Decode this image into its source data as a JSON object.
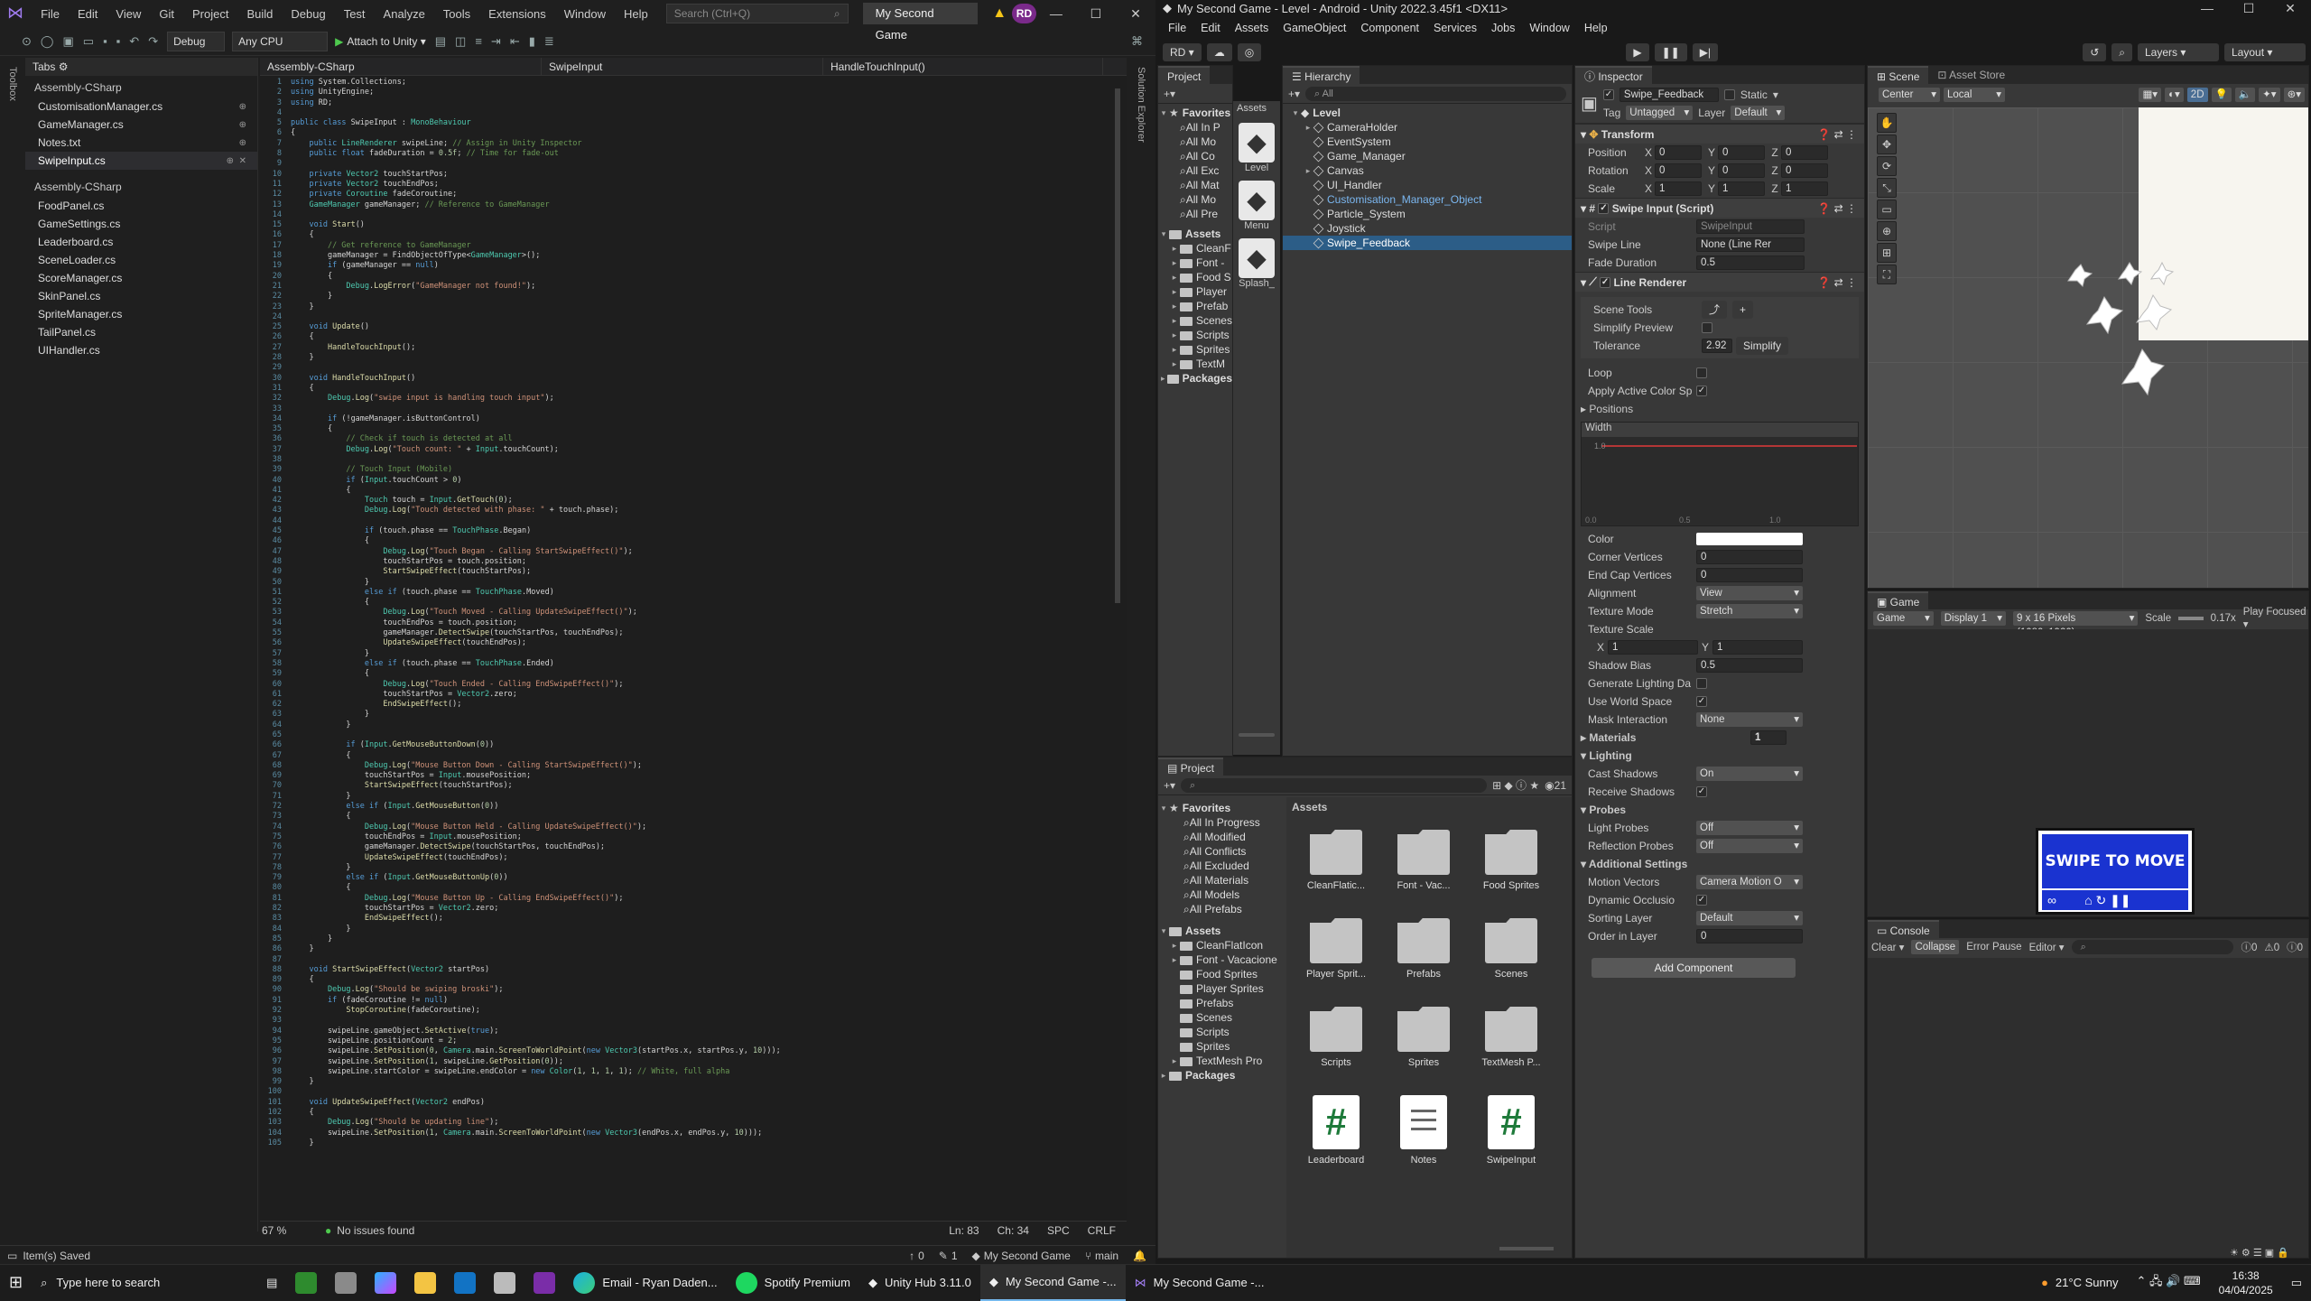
{
  "vs": {
    "menu": [
      "File",
      "Edit",
      "View",
      "Git",
      "Project",
      "Build",
      "Debug",
      "Test",
      "Analyze",
      "Tools",
      "Extensions",
      "Window",
      "Help"
    ],
    "search_placeholder": "Search (Ctrl+Q)",
    "solution_name": "My Second Game",
    "avatar": "RD",
    "config": "Debug",
    "platform": "Any CPU",
    "attach": "Attach to Unity",
    "left_strip": "Toolbox",
    "right_strip": "Solution Explorer",
    "tabs_header": "Tabs",
    "tab_groups": [
      {
        "name": "Assembly-CSharp",
        "items": [
          "CustomisationManager.cs",
          "GameManager.cs",
          "Notes.txt",
          "SwipeInput.cs"
        ]
      },
      {
        "name": "Assembly-CSharp",
        "items": [
          "FoodPanel.cs",
          "GameSettings.cs",
          "Leaderboard.cs",
          "SceneLoader.cs",
          "ScoreManager.cs",
          "SkinPanel.cs",
          "SpriteManager.cs",
          "TailPanel.cs",
          "UIHandler.cs"
        ]
      }
    ],
    "nav": [
      "Assembly-CSharp",
      "SwipeInput",
      "HandleTouchInput()"
    ],
    "status_editor": {
      "zoom": "67 %",
      "issues": "No issues found",
      "ln": "Ln: 83",
      "ch": "Ch: 34",
      "spc": "SPC",
      "crlf": "CRLF"
    },
    "status": {
      "saved": "Item(s) Saved",
      "up": "0",
      "pen": "1",
      "repo": "My Second Game",
      "branch": "main"
    },
    "code": [
      "using System.Collections;",
      "using UnityEngine;",
      "using RD;",
      "",
      "public class SwipeInput : MonoBehaviour",
      "{",
      "    public LineRenderer swipeLine; // Assign in Unity Inspector",
      "    public float fadeDuration = 0.5f; // Time for fade-out",
      "",
      "    private Vector2 touchStartPos;",
      "    private Vector2 touchEndPos;",
      "    private Coroutine fadeCoroutine;",
      "    GameManager gameManager; // Reference to GameManager",
      "",
      "    void Start()",
      "    {",
      "        // Get reference to GameManager",
      "        gameManager = FindObjectOfType<GameManager>();",
      "        if (gameManager == null)",
      "        {",
      "            Debug.LogError(\"GameManager not found!\");",
      "        }",
      "    }",
      "",
      "    void Update()",
      "    {",
      "        HandleTouchInput();",
      "    }",
      "",
      "    void HandleTouchInput()",
      "    {",
      "        Debug.Log(\"swipe input is handling touch input\");",
      "",
      "        if (!gameManager.isButtonControl)",
      "        {",
      "            // Check if touch is detected at all",
      "            Debug.Log(\"Touch count: \" + Input.touchCount);",
      "",
      "            // Touch Input (Mobile)",
      "            if (Input.touchCount > 0)",
      "            {",
      "                Touch touch = Input.GetTouch(0);",
      "                Debug.Log(\"Touch detected with phase: \" + touch.phase);",
      "",
      "                if (touch.phase == TouchPhase.Began)",
      "                {",
      "                    Debug.Log(\"Touch Began - Calling StartSwipeEffect()\");",
      "                    touchStartPos = touch.position;",
      "                    StartSwipeEffect(touchStartPos);",
      "                }",
      "                else if (touch.phase == TouchPhase.Moved)",
      "                {",
      "                    Debug.Log(\"Touch Moved - Calling UpdateSwipeEffect()\");",
      "                    touchEndPos = touch.position;",
      "                    gameManager.DetectSwipe(touchStartPos, touchEndPos);",
      "                    UpdateSwipeEffect(touchEndPos);",
      "                }",
      "                else if (touch.phase == TouchPhase.Ended)",
      "                {",
      "                    Debug.Log(\"Touch Ended - Calling EndSwipeEffect()\");",
      "                    touchStartPos = Vector2.zero;",
      "                    EndSwipeEffect();",
      "                }",
      "            }",
      "",
      "            if (Input.GetMouseButtonDown(0))",
      "            {",
      "                Debug.Log(\"Mouse Button Down - Calling StartSwipeEffect()\");",
      "                touchStartPos = Input.mousePosition;",
      "                StartSwipeEffect(touchStartPos);",
      "            }",
      "            else if (Input.GetMouseButton(0))",
      "            {",
      "                Debug.Log(\"Mouse Button Held - Calling UpdateSwipeEffect()\");",
      "                touchEndPos = Input.mousePosition;",
      "                gameManager.DetectSwipe(touchStartPos, touchEndPos);",
      "                UpdateSwipeEffect(touchEndPos);",
      "            }",
      "            else if (Input.GetMouseButtonUp(0))",
      "            {",
      "                Debug.Log(\"Mouse Button Up - Calling EndSwipeEffect()\");",
      "                touchStartPos = Vector2.zero;",
      "                EndSwipeEffect();",
      "            }",
      "        }",
      "    }",
      "",
      "    void StartSwipeEffect(Vector2 startPos)",
      "    {",
      "        Debug.Log(\"Should be swiping broski\");",
      "        if (fadeCoroutine != null)",
      "            StopCoroutine(fadeCoroutine);",
      "",
      "        swipeLine.gameObject.SetActive(true);",
      "        swipeLine.positionCount = 2;",
      "        swipeLine.SetPosition(0, Camera.main.ScreenToWorldPoint(new Vector3(startPos.x, startPos.y, 10)));",
      "        swipeLine.SetPosition(1, swipeLine.GetPosition(0));",
      "        swipeLine.startColor = swipeLine.endColor = new Color(1, 1, 1, 1); // White, full alpha",
      "    }",
      "",
      "    void UpdateSwipeEffect(Vector2 endPos)",
      "    {",
      "        Debug.Log(\"Should be updating line\");",
      "        swipeLine.SetPosition(1, Camera.main.ScreenToWorldPoint(new Vector3(endPos.x, endPos.y, 10)));",
      "    }"
    ]
  },
  "unity": {
    "title": "My Second Game - Level - Android - Unity 2022.3.45f1 <DX11>",
    "menu": [
      "File",
      "Edit",
      "Assets",
      "GameObject",
      "Component",
      "Services",
      "Jobs",
      "Window",
      "Help"
    ],
    "account": "RD",
    "layers": "Layers",
    "layout": "Layout",
    "project_tab": "Project",
    "project_top_favorites": [
      "All In P",
      "All Mo",
      "All Co",
      "All Exc",
      "All Mat",
      "All Mo",
      "All Pre"
    ],
    "project_top_assets": [
      "CleanF",
      "Font -",
      "Food S",
      "Player",
      "Prefab",
      "Scenes",
      "Scripts",
      "Sprites",
      "TextM"
    ],
    "project_top_icons": [
      "Level",
      "Menu",
      "Splash_"
    ],
    "hierarchy_tab": "Hierarchy",
    "hierarchy_search": "All",
    "hierarchy": [
      "Level",
      "CameraHolder",
      "EventSystem",
      "Game_Manager",
      "Canvas",
      "UI_Handler",
      "Customisation_Manager_Object",
      "Particle_System",
      "Joystick",
      "Swipe_Feedback"
    ],
    "inspector": {
      "tab": "Inspector",
      "name": "Swipe_Feedback",
      "static": "Static",
      "tag_label": "Tag",
      "tag": "Untagged",
      "layer_label": "Layer",
      "layer": "Default",
      "transform": "Transform",
      "pos_label": "Position",
      "rot_label": "Rotation",
      "scale_label": "Scale",
      "pos": [
        "0",
        "0",
        "0"
      ],
      "rot": [
        "0",
        "0",
        "0"
      ],
      "scale": [
        "1",
        "1",
        "1"
      ],
      "swipe_comp": "Swipe Input (Script)",
      "script_label": "Script",
      "script": "SwipeInput",
      "swipe_line_label": "Swipe Line",
      "swipe_line": "None (Line Rer",
      "fade_label": "Fade Duration",
      "fade": "0.5",
      "lr_comp": "Line Renderer",
      "scene_tools": "Scene Tools",
      "simplify_preview": "Simplify Preview",
      "tolerance_label": "Tolerance",
      "tolerance": "2.92",
      "simplify": "Simplify",
      "loop": "Loop",
      "apply_color": "Apply Active Color Sp",
      "positions": "Positions",
      "width": "Width",
      "width_val": "1.0",
      "width_axis": [
        "0.0",
        "0.5",
        "1.0"
      ],
      "color": "Color",
      "corner": "Corner Vertices",
      "corner_v": "0",
      "endcap": "End Cap Vertices",
      "endcap_v": "0",
      "alignment": "Alignment",
      "alignment_v": "View",
      "texmode": "Texture Mode",
      "texmode_v": "Stretch",
      "texscale": "Texture Scale",
      "tsx": "1",
      "tsy": "1",
      "shadow_bias": "Shadow Bias",
      "shadow_bias_v": "0.5",
      "gen_light": "Generate Lighting Da",
      "use_world": "Use World Space",
      "mask": "Mask Interaction",
      "mask_v": "None",
      "materials": "Materials",
      "materials_v": "1",
      "lighting": "Lighting",
      "cast": "Cast Shadows",
      "cast_v": "On",
      "receive": "Receive Shadows",
      "probes": "Probes",
      "light_probes": "Light Probes",
      "light_probes_v": "Off",
      "refl": "Reflection Probes",
      "refl_v": "Off",
      "additional": "Additional Settings",
      "motion": "Motion Vectors",
      "motion_v": "Camera Motion O",
      "dyn": "Dynamic Occlusio",
      "sorting": "Sorting Layer",
      "sorting_v": "Default",
      "order": "Order in Layer",
      "order_v": "0",
      "add_component": "Add Component"
    },
    "scene": {
      "tab": "Scene",
      "store": "Asset Store",
      "pivot": "Center",
      "space": "Local",
      "mode2d": "2D"
    },
    "game": {
      "tab": "Game",
      "mode": "Game",
      "display": "Display 1",
      "res": "9 x 16 Pixels (1080x1920)",
      "scale_label": "Scale",
      "scale": "0.17x",
      "focused": "Play Focused",
      "preview_text": "SWIPE TO MOVE"
    },
    "project2": {
      "tab": "Project",
      "count": "21",
      "favorites": [
        "Favorites",
        "All In Progress",
        "All Modified",
        "All Conflicts",
        "All Excluded",
        "All Materials",
        "All Models",
        "All Prefabs"
      ],
      "assets": [
        "Assets",
        "CleanFlatIcon",
        "Font - Vacacione",
        "Food Sprites",
        "Player Sprites",
        "Prefabs",
        "Scenes",
        "Scripts",
        "Sprites",
        "TextMesh Pro"
      ],
      "packages": "Packages",
      "assets_header": "Assets",
      "grid": [
        "CleanFlatic...",
        "Font - Vac...",
        "Food Sprites",
        "Player Sprit...",
        "Prefabs",
        "Scenes",
        "Scripts",
        "Sprites",
        "TextMesh P...",
        "Leaderboard",
        "Notes",
        "SwipeInput"
      ]
    },
    "console": {
      "tab": "Console",
      "clear": "Clear",
      "collapse": "Collapse",
      "error_pause": "Error Pause",
      "editor": "Editor",
      "c1": "0",
      "c2": "0",
      "c3": "0"
    }
  },
  "taskbar": {
    "search": "Type here to search",
    "apps": [
      "Email - Ryan Daden...",
      "Spotify Premium",
      "Unity Hub 3.11.0",
      "My Second Game -...",
      "My Second Game -..."
    ],
    "weather": "21°C  Sunny",
    "time": "16:38",
    "date": "04/04/2025"
  }
}
